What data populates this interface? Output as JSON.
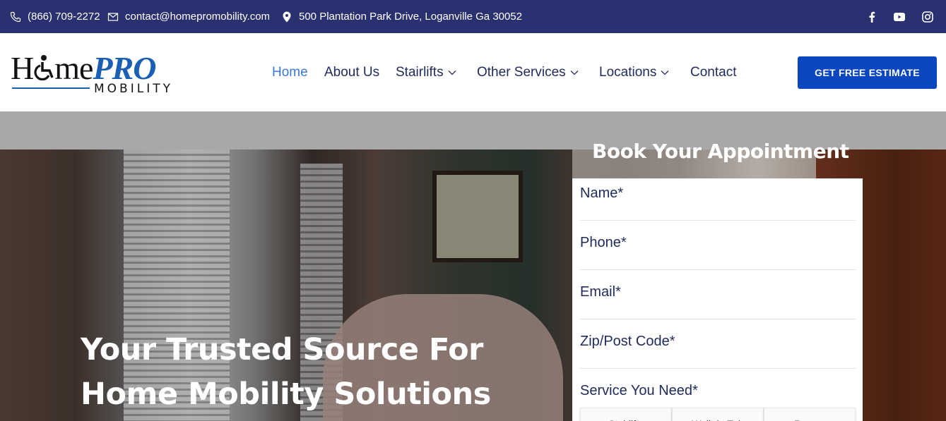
{
  "topbar": {
    "phone": "(866) 709-2272",
    "email": "contact@homepromobility.com",
    "address": "500 Plantation Park Drive, Loganville Ga 30052",
    "social": [
      "facebook-icon",
      "youtube-icon",
      "instagram-icon"
    ]
  },
  "logo": {
    "home": "H",
    "me": "me",
    "pro": "PRO",
    "mobility": "MOBILITY"
  },
  "nav": {
    "home": "Home",
    "about": "About Us",
    "stairlifts": "Stairlifts",
    "other": "Other Services",
    "locations": "Locations",
    "contact": "Contact",
    "cta": "GET FREE ESTIMATE"
  },
  "hero": {
    "title_line1": "Your Trusted Source For",
    "title_line2": "Home Mobility Solutions"
  },
  "form": {
    "title": "Book Your Appointment",
    "fields": [
      "Name*",
      "Phone*",
      "Email*",
      "Zip/Post Code*"
    ],
    "service_label": "Service You Need*",
    "service_options": [
      "Stairlifts",
      "Walk-in Tub",
      "Ramps"
    ]
  },
  "colors": {
    "topbar": "#2a3170",
    "nav_text": "#1f2a5c",
    "nav_active": "#3b78d4",
    "cta": "#0a46bf"
  }
}
